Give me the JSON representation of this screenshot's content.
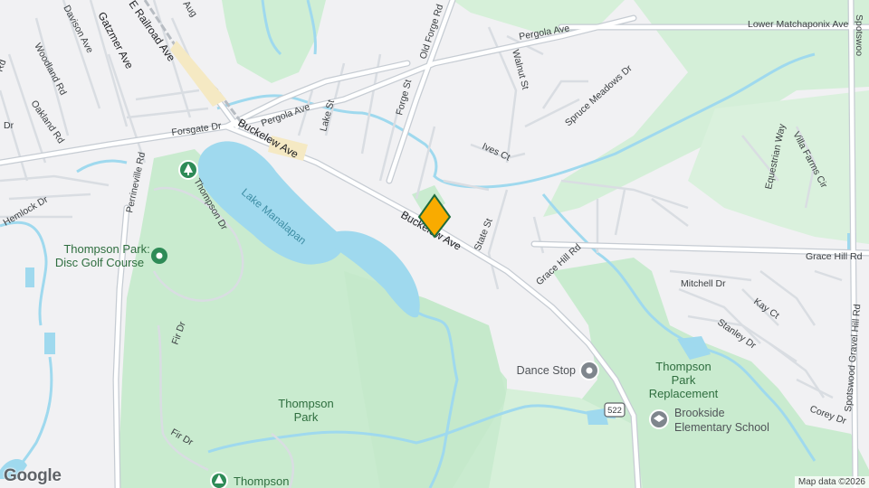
{
  "map": {
    "colors": {
      "land": "#f1f1f3",
      "park": "#c9ebcf",
      "park_light": "#dcf2df",
      "water": "#9fd9ee",
      "road": "#ffffff",
      "road_casing": "#c6ccd3",
      "minor_road": "#d9dde2",
      "stream": "#9fd9ee",
      "pin": "#f9ab00",
      "pin_border": "#1e6b3a"
    },
    "roads": [
      {
        "id": "pergola-ave",
        "label": "Pergola Ave"
      },
      {
        "id": "lower-matchaponix",
        "label": "Lower Matchaponix Ave"
      },
      {
        "id": "spotswood-top",
        "label": "Spotswoo"
      },
      {
        "id": "pergola-ave-2",
        "label": "Pergola Ave"
      },
      {
        "id": "forsgate-dr",
        "label": "Forsgate Dr"
      },
      {
        "id": "buckelew-ave-1",
        "label": "Buckelew Ave"
      },
      {
        "id": "buckelew-ave-2",
        "label": "Buckelew Ave"
      },
      {
        "id": "old-forge-rd",
        "label": "Old Forge Rd"
      },
      {
        "id": "forge-st",
        "label": "Forge St"
      },
      {
        "id": "lake-st",
        "label": "Lake St"
      },
      {
        "id": "walnut-st",
        "label": "Walnut St"
      },
      {
        "id": "spruce-meadows",
        "label": "Spruce Meadows Dr"
      },
      {
        "id": "ives-ct",
        "label": "Ives Ct"
      },
      {
        "id": "state-st",
        "label": "State St"
      },
      {
        "id": "grace-hill-rd-1",
        "label": "Grace Hill Rd"
      },
      {
        "id": "grace-hill-rd-2",
        "label": "Grace Hill Rd"
      },
      {
        "id": "mitchell-dr",
        "label": "Mitchell Dr"
      },
      {
        "id": "kay-ct",
        "label": "Kay Ct"
      },
      {
        "id": "stanley-dr",
        "label": "Stanley Dr"
      },
      {
        "id": "corey-dr",
        "label": "Corey Dr"
      },
      {
        "id": "spotswood-gravel-hill",
        "label": "Spotswood Gravel Hill Rd"
      },
      {
        "id": "equestrian-way",
        "label": "Equestrian Way"
      },
      {
        "id": "villa-farms-cir",
        "label": "Villa Farms Cir"
      },
      {
        "id": "thompson-dr",
        "label": "Thompson Dr"
      },
      {
        "id": "fir-dr-1",
        "label": "Fir Dr"
      },
      {
        "id": "fir-dr-2",
        "label": "Fir Dr"
      },
      {
        "id": "perrineville-rd",
        "label": "Perrineville Rd"
      },
      {
        "id": "hemlock-dr",
        "label": "Hemlock Dr"
      },
      {
        "id": "oakland-rd",
        "label": "Oakland Rd"
      },
      {
        "id": "woodland-rd",
        "label": "Woodland Rd"
      },
      {
        "id": "davison-ave",
        "label": "Davison Ave"
      },
      {
        "id": "gatzmer-ave",
        "label": "Gatzmer Ave"
      },
      {
        "id": "railroad-ave",
        "label": "E Railroad Ave"
      },
      {
        "id": "aug",
        "label": "Aug"
      },
      {
        "id": "rd-left",
        "label": "Rd"
      },
      {
        "id": "dr-left",
        "label": "Dr"
      }
    ],
    "water_labels": [
      {
        "id": "lake-manalapan",
        "label": "Lake Manalapan"
      }
    ],
    "park_labels": [
      {
        "id": "thompson-park",
        "label": "Thompson Park"
      },
      {
        "id": "thompson-park-replacement",
        "label": "Thompson Park Replacement"
      },
      {
        "id": "thompson-bottom",
        "label": "Thompson"
      }
    ],
    "pois": [
      {
        "id": "disc-golf",
        "label": "Thompson Park: Disc Golf Course",
        "icon": "park-pin-icon"
      },
      {
        "id": "dance-stop",
        "label": "Dance Stop",
        "icon": "place-pin-icon"
      },
      {
        "id": "brookside",
        "label": "Brookside Elementary School",
        "icon": "school-icon"
      },
      {
        "id": "tree-top",
        "label": "",
        "icon": "tree-icon"
      },
      {
        "id": "tree-bottom",
        "label": "",
        "icon": "tree-icon"
      }
    ],
    "route_shield": "522",
    "logo": "Google",
    "attribution": "Map data ©2026"
  }
}
